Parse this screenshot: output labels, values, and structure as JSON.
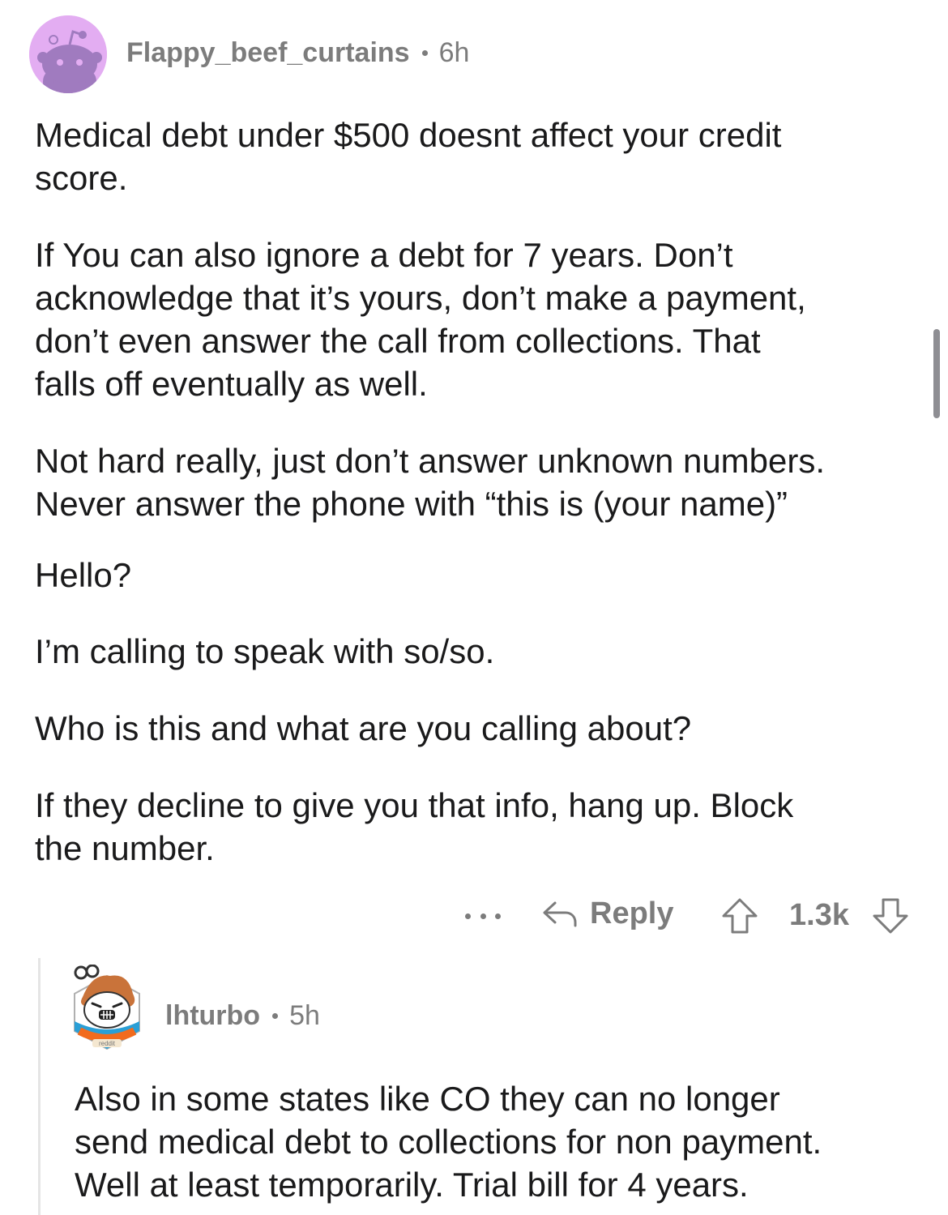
{
  "comment": {
    "username": "Flappy_beef_curtains",
    "age": "6h",
    "paragraphs": [
      "Medical debt under $500 doesnt affect your credit\nscore.",
      "If You can also ignore a debt for 7 years.   Don’t\nacknowledge that it’s yours, don’t make a payment,\ndon’t even answer the call from collections. That\nfalls off eventually as well.",
      "Not hard really, just don’t answer unknown numbers.\nNever answer the phone with “this is (your name)”",
      "Hello?",
      "I’m calling to speak with so/so.",
      "Who is this and what are you calling about?",
      "If they decline to give you that info, hang up.  Block\nthe number."
    ],
    "actions": {
      "reply_label": "Reply",
      "vote_count": "1.3k"
    }
  },
  "reply": {
    "username": "lhturbo",
    "age": "5h",
    "avatar_badge": "reddit",
    "text": "Also in some states like CO they can no longer\nsend medical debt to collections for non payment.\nWell at least temporarily. Trial bill for 4 years."
  },
  "colors": {
    "avatar_bg": "#e3adf2",
    "avatar_snoo": "#a07bbf",
    "meta_text": "#7c7c7c",
    "body_text": "#1a1a1b",
    "thread_line": "#e5e5e5"
  },
  "icons": [
    "snoo-avatar-icon",
    "more-icon",
    "reply-arrow-icon",
    "upvote-icon",
    "downvote-icon",
    "custom-snoo-avatar-icon"
  ]
}
